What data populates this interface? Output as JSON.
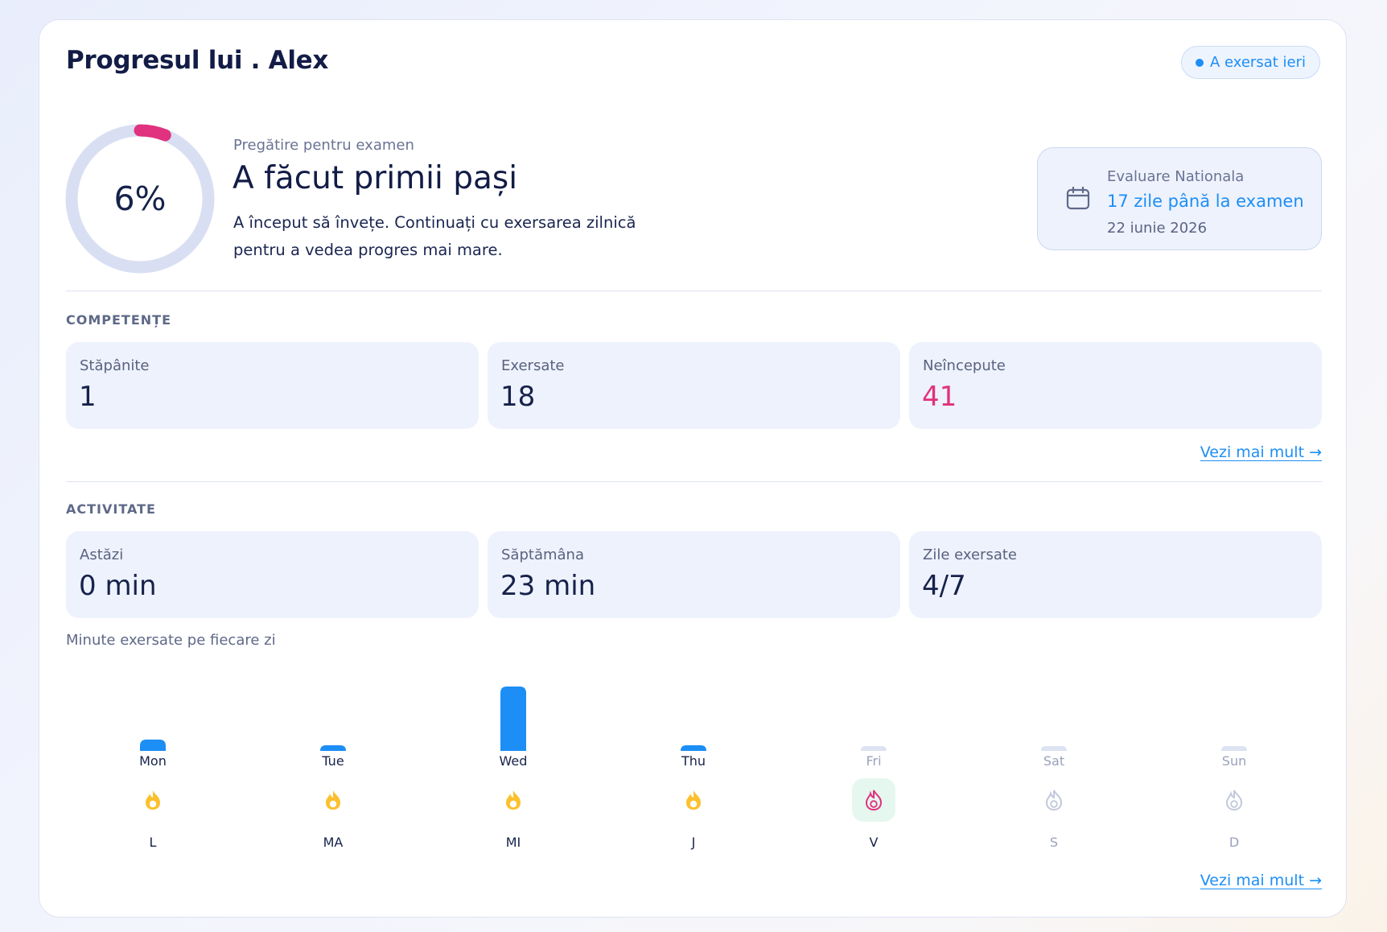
{
  "header": {
    "title": "Progresul lui . Alex",
    "status_badge": "A exersat ieri"
  },
  "progress": {
    "percent_label": "6%",
    "percent": 6,
    "section_label": "Pregătire pentru examen",
    "level_heading": "A făcut primii pași",
    "description": "A început să învețe. Continuați cu exersarea zilnică pentru a vedea progres mai mare."
  },
  "exam": {
    "name": "Evaluare Nationala",
    "countdown": "17 zile până la examen",
    "date": "22 iunie 2026",
    "icon": "calendar-icon"
  },
  "competente": {
    "title": "COMPETENȚE",
    "stats": [
      {
        "label": "Stăpânite",
        "value": "1"
      },
      {
        "label": "Exersate",
        "value": "18"
      },
      {
        "label": "Neîncepute",
        "value": "41"
      }
    ],
    "more_link": "Vezi mai mult →"
  },
  "activitate": {
    "title": "ACTIVITATE",
    "stats": [
      {
        "label": "Astăzi",
        "value": "0 min"
      },
      {
        "label": "Săptămâna",
        "value": "23 min"
      },
      {
        "label": "Zile exersate",
        "value": "4/7"
      }
    ],
    "chart_title": "Minute exersate pe fiecare zi",
    "more_link": "Vezi mai mult →"
  },
  "chart_data": {
    "type": "bar",
    "title": "Minute exersate pe fiecare zi",
    "categories": [
      "Mon",
      "Tue",
      "Wed",
      "Thu",
      "Fri",
      "Sat",
      "Sun"
    ],
    "values": [
      3,
      1,
      17,
      1,
      0,
      0,
      0
    ],
    "ylim": [
      0,
      17
    ],
    "colors": {
      "active": "#1c8ef6",
      "empty": "#dde3f3"
    }
  },
  "streak": {
    "days": [
      {
        "letter": "L",
        "state": "done",
        "icon": "flame-icon"
      },
      {
        "letter": "MA",
        "state": "done",
        "icon": "flame-icon"
      },
      {
        "letter": "MI",
        "state": "done",
        "icon": "flame-icon"
      },
      {
        "letter": "J",
        "state": "done",
        "icon": "flame-icon"
      },
      {
        "letter": "V",
        "state": "today",
        "icon": "flame-outline-icon"
      },
      {
        "letter": "S",
        "state": "future",
        "icon": "flame-outline-icon"
      },
      {
        "letter": "D",
        "state": "future",
        "icon": "flame-outline-icon"
      }
    ]
  },
  "colors": {
    "accent": "#1c8ef6",
    "pink": "#e0327e",
    "flame": "#fbc02d",
    "ring_track": "#d9dff3"
  }
}
